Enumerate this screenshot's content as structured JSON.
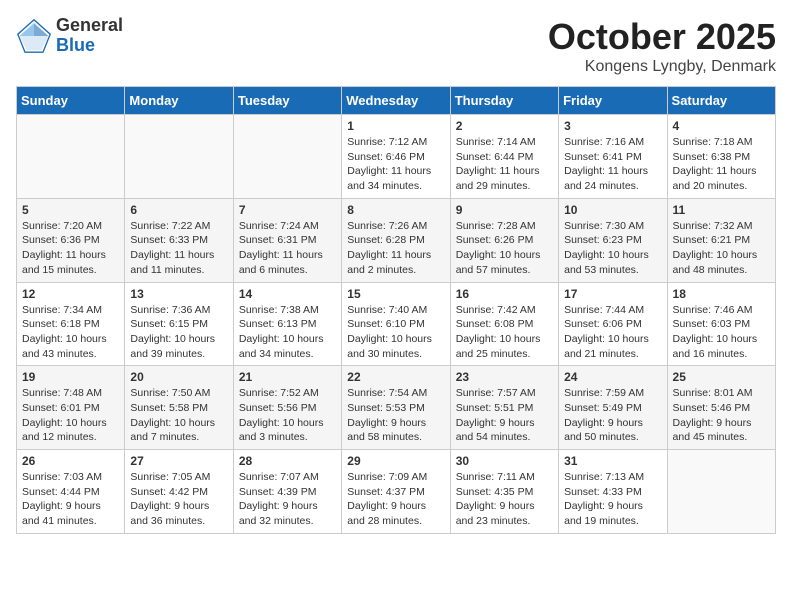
{
  "header": {
    "logo_general": "General",
    "logo_blue": "Blue",
    "month": "October 2025",
    "location": "Kongens Lyngby, Denmark"
  },
  "days_of_week": [
    "Sunday",
    "Monday",
    "Tuesday",
    "Wednesday",
    "Thursday",
    "Friday",
    "Saturday"
  ],
  "weeks": [
    [
      {
        "day": null,
        "info": null
      },
      {
        "day": null,
        "info": null
      },
      {
        "day": null,
        "info": null
      },
      {
        "day": "1",
        "info": "Sunrise: 7:12 AM\nSunset: 6:46 PM\nDaylight: 11 hours\nand 34 minutes."
      },
      {
        "day": "2",
        "info": "Sunrise: 7:14 AM\nSunset: 6:44 PM\nDaylight: 11 hours\nand 29 minutes."
      },
      {
        "day": "3",
        "info": "Sunrise: 7:16 AM\nSunset: 6:41 PM\nDaylight: 11 hours\nand 24 minutes."
      },
      {
        "day": "4",
        "info": "Sunrise: 7:18 AM\nSunset: 6:38 PM\nDaylight: 11 hours\nand 20 minutes."
      }
    ],
    [
      {
        "day": "5",
        "info": "Sunrise: 7:20 AM\nSunset: 6:36 PM\nDaylight: 11 hours\nand 15 minutes."
      },
      {
        "day": "6",
        "info": "Sunrise: 7:22 AM\nSunset: 6:33 PM\nDaylight: 11 hours\nand 11 minutes."
      },
      {
        "day": "7",
        "info": "Sunrise: 7:24 AM\nSunset: 6:31 PM\nDaylight: 11 hours\nand 6 minutes."
      },
      {
        "day": "8",
        "info": "Sunrise: 7:26 AM\nSunset: 6:28 PM\nDaylight: 11 hours\nand 2 minutes."
      },
      {
        "day": "9",
        "info": "Sunrise: 7:28 AM\nSunset: 6:26 PM\nDaylight: 10 hours\nand 57 minutes."
      },
      {
        "day": "10",
        "info": "Sunrise: 7:30 AM\nSunset: 6:23 PM\nDaylight: 10 hours\nand 53 minutes."
      },
      {
        "day": "11",
        "info": "Sunrise: 7:32 AM\nSunset: 6:21 PM\nDaylight: 10 hours\nand 48 minutes."
      }
    ],
    [
      {
        "day": "12",
        "info": "Sunrise: 7:34 AM\nSunset: 6:18 PM\nDaylight: 10 hours\nand 43 minutes."
      },
      {
        "day": "13",
        "info": "Sunrise: 7:36 AM\nSunset: 6:15 PM\nDaylight: 10 hours\nand 39 minutes."
      },
      {
        "day": "14",
        "info": "Sunrise: 7:38 AM\nSunset: 6:13 PM\nDaylight: 10 hours\nand 34 minutes."
      },
      {
        "day": "15",
        "info": "Sunrise: 7:40 AM\nSunset: 6:10 PM\nDaylight: 10 hours\nand 30 minutes."
      },
      {
        "day": "16",
        "info": "Sunrise: 7:42 AM\nSunset: 6:08 PM\nDaylight: 10 hours\nand 25 minutes."
      },
      {
        "day": "17",
        "info": "Sunrise: 7:44 AM\nSunset: 6:06 PM\nDaylight: 10 hours\nand 21 minutes."
      },
      {
        "day": "18",
        "info": "Sunrise: 7:46 AM\nSunset: 6:03 PM\nDaylight: 10 hours\nand 16 minutes."
      }
    ],
    [
      {
        "day": "19",
        "info": "Sunrise: 7:48 AM\nSunset: 6:01 PM\nDaylight: 10 hours\nand 12 minutes."
      },
      {
        "day": "20",
        "info": "Sunrise: 7:50 AM\nSunset: 5:58 PM\nDaylight: 10 hours\nand 7 minutes."
      },
      {
        "day": "21",
        "info": "Sunrise: 7:52 AM\nSunset: 5:56 PM\nDaylight: 10 hours\nand 3 minutes."
      },
      {
        "day": "22",
        "info": "Sunrise: 7:54 AM\nSunset: 5:53 PM\nDaylight: 9 hours\nand 58 minutes."
      },
      {
        "day": "23",
        "info": "Sunrise: 7:57 AM\nSunset: 5:51 PM\nDaylight: 9 hours\nand 54 minutes."
      },
      {
        "day": "24",
        "info": "Sunrise: 7:59 AM\nSunset: 5:49 PM\nDaylight: 9 hours\nand 50 minutes."
      },
      {
        "day": "25",
        "info": "Sunrise: 8:01 AM\nSunset: 5:46 PM\nDaylight: 9 hours\nand 45 minutes."
      }
    ],
    [
      {
        "day": "26",
        "info": "Sunrise: 7:03 AM\nSunset: 4:44 PM\nDaylight: 9 hours\nand 41 minutes."
      },
      {
        "day": "27",
        "info": "Sunrise: 7:05 AM\nSunset: 4:42 PM\nDaylight: 9 hours\nand 36 minutes."
      },
      {
        "day": "28",
        "info": "Sunrise: 7:07 AM\nSunset: 4:39 PM\nDaylight: 9 hours\nand 32 minutes."
      },
      {
        "day": "29",
        "info": "Sunrise: 7:09 AM\nSunset: 4:37 PM\nDaylight: 9 hours\nand 28 minutes."
      },
      {
        "day": "30",
        "info": "Sunrise: 7:11 AM\nSunset: 4:35 PM\nDaylight: 9 hours\nand 23 minutes."
      },
      {
        "day": "31",
        "info": "Sunrise: 7:13 AM\nSunset: 4:33 PM\nDaylight: 9 hours\nand 19 minutes."
      },
      {
        "day": null,
        "info": null
      }
    ]
  ]
}
